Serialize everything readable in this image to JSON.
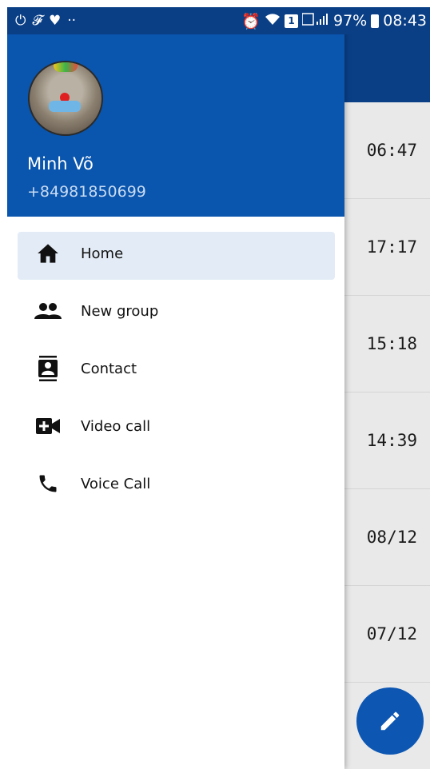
{
  "status_bar": {
    "left_glyphs": [
      "⏻",
      "𝓕",
      "♥",
      "··"
    ],
    "battery": "97%",
    "time": "08:43",
    "sim_badge": "1"
  },
  "drawer": {
    "user": {
      "name": "Minh Võ",
      "phone": "+84981850699"
    },
    "menu": [
      {
        "label": "Home",
        "icon": "home-icon",
        "active": true
      },
      {
        "label": "New group",
        "icon": "group-icon",
        "active": false
      },
      {
        "label": "Contact",
        "icon": "contact-icon",
        "active": false
      },
      {
        "label": "Video call",
        "icon": "video-call-icon",
        "active": false
      },
      {
        "label": "Voice Call",
        "icon": "phone-icon",
        "active": false
      }
    ]
  },
  "background_list": {
    "times": [
      "06:47",
      "17:17",
      "15:18",
      "14:39",
      "08/12",
      "07/12"
    ]
  },
  "colors": {
    "primary": "#0a55ad",
    "status_bar": "#0a3f86",
    "active_item": "#e3ecf6",
    "fab": "#0d57b3"
  }
}
